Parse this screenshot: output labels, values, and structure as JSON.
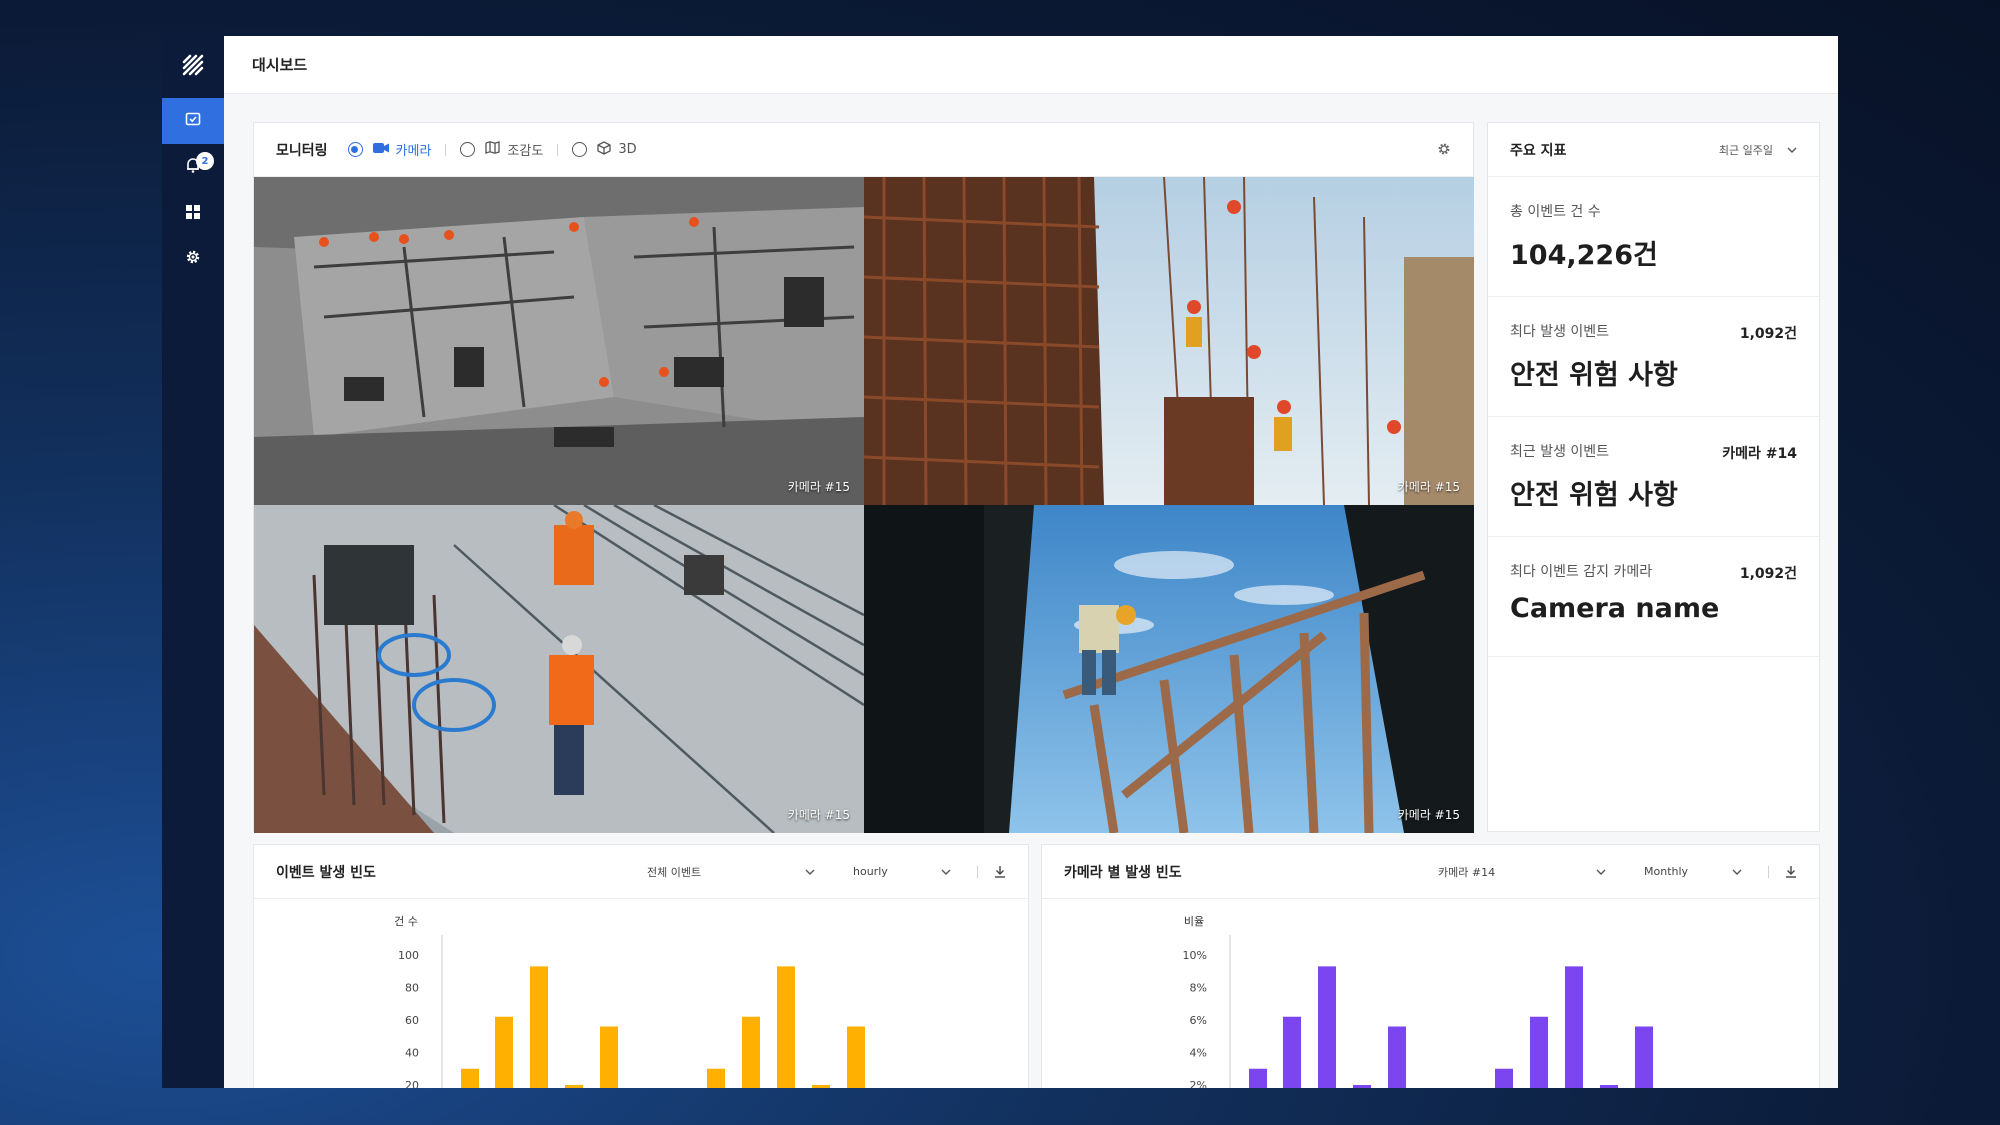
{
  "topbar": {
    "title": "대시보드"
  },
  "sidebar": {
    "notification_count": "2"
  },
  "monitoring": {
    "title": "모니터링",
    "options": [
      "카메라",
      "조감도",
      "3D"
    ],
    "cameras": [
      "카메라 #15",
      "카메라 #15",
      "카메라 #15",
      "카메라 #15"
    ]
  },
  "kpi": {
    "title": "주요 지표",
    "period": "최근 일주일",
    "cards": [
      {
        "label": "총 이벤트 건 수",
        "side": "",
        "value": "104,226건"
      },
      {
        "label": "최다 발생 이벤트",
        "side": "1,092건",
        "value": "안전 위험 사항"
      },
      {
        "label": "최근 발생 이벤트",
        "side": "카메라 #14",
        "value": "안전 위험 사항"
      },
      {
        "label": "최다 이벤트 감지 카메라",
        "side": "1,092건",
        "value": "Camera name"
      }
    ]
  },
  "event_chart": {
    "title": "이벤트 발생 빈도",
    "filter": "전체 이벤트",
    "interval": "hourly"
  },
  "camera_chart": {
    "title": "카메라 별 발생 빈도",
    "filter": "카메라 #14",
    "interval": "Monthly"
  },
  "chart_data": [
    {
      "type": "bar",
      "ylabel": "건 수",
      "yticks": [
        "100",
        "80",
        "60",
        "40",
        "20"
      ],
      "ylim": [
        0,
        100
      ],
      "color": "#ffb000",
      "values": [
        30,
        62,
        93,
        20,
        56,
        0,
        0,
        30,
        62,
        93,
        20,
        56
      ]
    },
    {
      "type": "bar",
      "ylabel": "비율",
      "yticks": [
        "10%",
        "8%",
        "6%",
        "4%",
        "2%"
      ],
      "ylim": [
        0,
        10
      ],
      "color": "#7b45f0",
      "values": [
        3,
        6.2,
        9.3,
        2,
        5.6,
        0,
        0,
        3,
        6.2,
        9.3,
        2,
        5.6
      ]
    }
  ]
}
